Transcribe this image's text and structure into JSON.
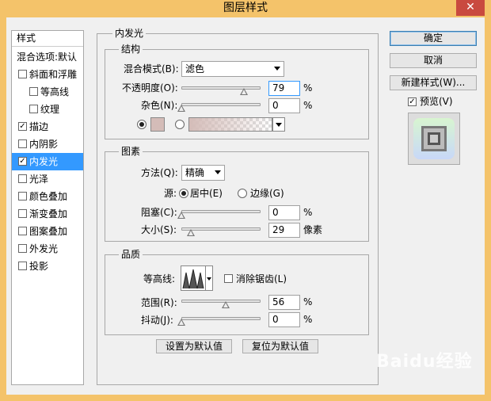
{
  "window": {
    "title": "图层样式",
    "close_symbol": "✕"
  },
  "styles_panel": {
    "header": "样式",
    "blend_defaults": "混合选项:默认",
    "items": [
      {
        "label": "斜面和浮雕",
        "checked": false,
        "indent": false
      },
      {
        "label": "等高线",
        "checked": false,
        "indent": true
      },
      {
        "label": "纹理",
        "checked": false,
        "indent": true
      },
      {
        "label": "描边",
        "checked": true,
        "indent": false
      },
      {
        "label": "内阴影",
        "checked": false,
        "indent": false
      },
      {
        "label": "内发光",
        "checked": true,
        "indent": false,
        "selected": true
      },
      {
        "label": "光泽",
        "checked": false,
        "indent": false
      },
      {
        "label": "颜色叠加",
        "checked": false,
        "indent": false
      },
      {
        "label": "渐变叠加",
        "checked": false,
        "indent": false
      },
      {
        "label": "图案叠加",
        "checked": false,
        "indent": false
      },
      {
        "label": "外发光",
        "checked": false,
        "indent": false
      },
      {
        "label": "投影",
        "checked": false,
        "indent": false
      }
    ]
  },
  "inner_glow": {
    "title": "内发光",
    "structure": {
      "title": "结构",
      "blend_mode_label": "混合模式(B):",
      "blend_mode_value": "滤色",
      "opacity_label": "不透明度(O):",
      "opacity_value": "79",
      "opacity_level": 79,
      "noise_label": "杂色(N):",
      "noise_value": "0",
      "noise_level": 0,
      "percent": "%",
      "color_swatch": "#d4bcb8"
    },
    "elements": {
      "title": "图素",
      "technique_label": "方法(Q):",
      "technique_value": "精确",
      "source_label": "源:",
      "center_label": "居中(E)",
      "edge_label": "边缘(G)",
      "choke_label": "阻塞(C):",
      "choke_value": "0",
      "choke_level": 0,
      "size_label": "大小(S):",
      "size_value": "29",
      "size_level": 12,
      "size_unit": "像素",
      "percent": "%"
    },
    "quality": {
      "title": "品质",
      "contour_label": "等高线:",
      "antialias_label": "消除锯齿(L)",
      "range_label": "范围(R):",
      "range_value": "56",
      "range_level": 56,
      "jitter_label": "抖动(J):",
      "jitter_value": "0",
      "jitter_level": 0,
      "percent": "%"
    },
    "set_default_button": "设置为默认值",
    "reset_default_button": "复位为默认值"
  },
  "right_panel": {
    "ok_button": "确定",
    "cancel_button": "取消",
    "new_style_button": "新建样式(W)...",
    "preview_label": "预览(V)",
    "preview_checked": true
  },
  "watermark": "Baidu经验"
}
